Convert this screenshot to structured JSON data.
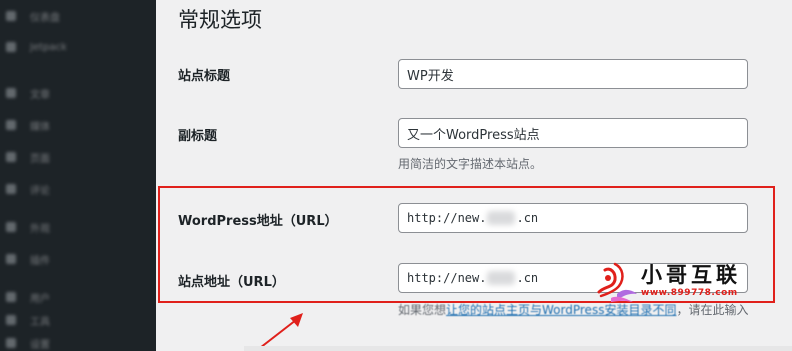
{
  "sidebar": {
    "items": [
      {
        "label": "仪表盘",
        "icon": "dashboard-icon"
      },
      {
        "label": "Jetpack",
        "icon": "jetpack-icon"
      },
      {
        "label": "文章",
        "icon": "pin-icon"
      },
      {
        "label": "媒体",
        "icon": "media-icon"
      },
      {
        "label": "页面",
        "icon": "page-icon"
      },
      {
        "label": "评论",
        "icon": "comment-icon"
      },
      {
        "label": "外观",
        "icon": "brush-icon"
      },
      {
        "label": "插件",
        "icon": "plugin-icon"
      },
      {
        "label": "用户",
        "icon": "user-icon"
      },
      {
        "label": "工具",
        "icon": "tool-icon"
      },
      {
        "label": "设置",
        "icon": "settings-icon"
      }
    ]
  },
  "page": {
    "title": "常规选项"
  },
  "settings": {
    "site_title": {
      "label": "站点标题",
      "value": "WP开发"
    },
    "tagline": {
      "label": "副标题",
      "value": "又一个WordPress站点",
      "description": "用简洁的文字描述本站点。"
    },
    "wp_address": {
      "label": "WordPress地址（URL）",
      "value_prefix": "http://new.",
      "value_suffix": ".cn"
    },
    "site_address": {
      "label": "站点地址（URL）",
      "value_prefix": "http://new.",
      "value_suffix": ".cn",
      "description_prefix": "如果您想",
      "description_link": "让您的站点主页与WordPress安装目录不同",
      "description_suffix": "，请在此输入"
    }
  },
  "annotation": {
    "box_color": "#e0201b",
    "arrow_color": "#e0201b"
  },
  "watermark": {
    "title": "小哥互联",
    "url": "www.899778.com"
  }
}
